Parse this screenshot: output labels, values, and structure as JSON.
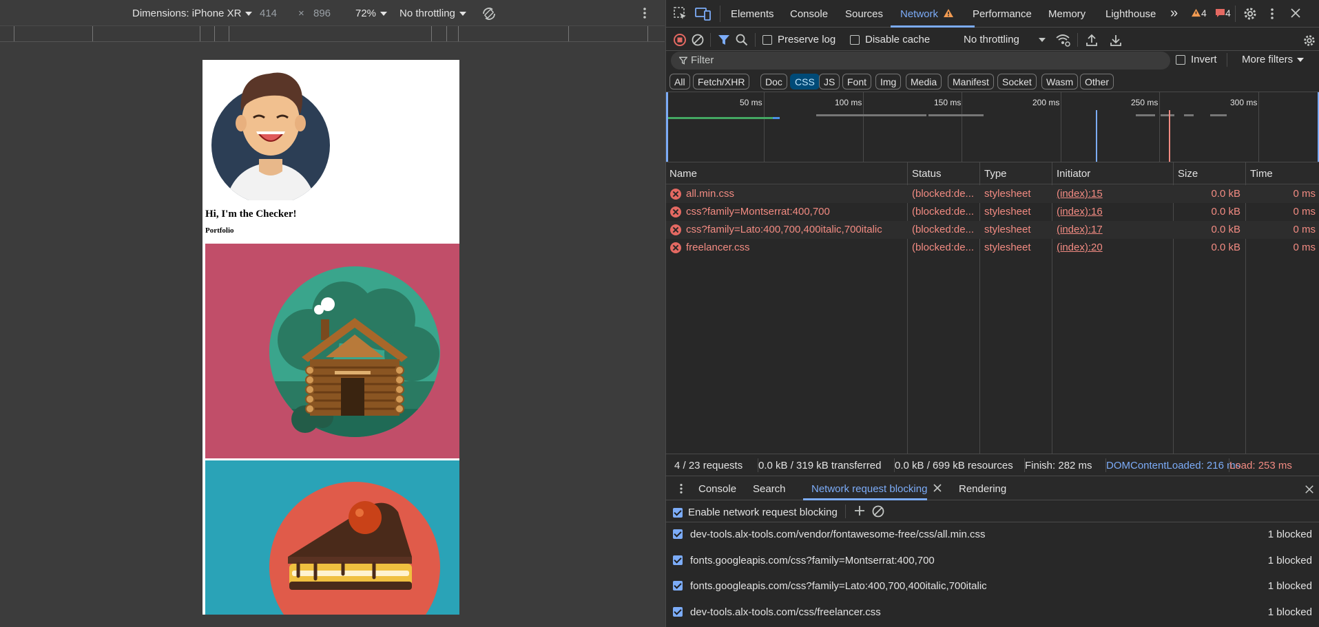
{
  "device_toolbar": {
    "dimensions_label": "Dimensions: iPhone XR",
    "width": "414",
    "times": "×",
    "height": "896",
    "zoom": "72%",
    "throttling": "No throttling"
  },
  "page": {
    "heading": "Hi, I'm the Checker!",
    "subheading": "Portfolio"
  },
  "devtools": {
    "tabs": [
      "Elements",
      "Console",
      "Sources",
      "Network",
      "Performance",
      "Memory",
      "Lighthouse"
    ],
    "more_tabs": "»",
    "warnings_count": "4",
    "errors_count": "4",
    "toolbar": {
      "preserve_log": "Preserve log",
      "disable_cache": "Disable cache",
      "throttling": "No throttling"
    },
    "filter": {
      "placeholder": "Filter",
      "invert": "Invert",
      "more_filters": "More filters"
    },
    "type_chips": [
      "All",
      "Fetch/XHR",
      "Doc",
      "CSS",
      "JS",
      "Font",
      "Img",
      "Media",
      "Manifest",
      "Socket",
      "Wasm",
      "Other"
    ],
    "active_chip": "CSS",
    "overview_ticks": [
      "50 ms",
      "100 ms",
      "150 ms",
      "200 ms",
      "250 ms",
      "300 ms"
    ],
    "columns": [
      "Name",
      "Status",
      "Type",
      "Initiator",
      "Size",
      "Time"
    ],
    "requests": [
      {
        "name": "all.min.css",
        "status": "(blocked:de...",
        "type": "stylesheet",
        "initiator": "(index):15",
        "size": "0.0 kB",
        "time": "0 ms"
      },
      {
        "name": "css?family=Montserrat:400,700",
        "status": "(blocked:de...",
        "type": "stylesheet",
        "initiator": "(index):16",
        "size": "0.0 kB",
        "time": "0 ms"
      },
      {
        "name": "css?family=Lato:400,700,400italic,700italic",
        "status": "(blocked:de...",
        "type": "stylesheet",
        "initiator": "(index):17",
        "size": "0.0 kB",
        "time": "0 ms"
      },
      {
        "name": "freelancer.css",
        "status": "(blocked:de...",
        "type": "stylesheet",
        "initiator": "(index):20",
        "size": "0.0 kB",
        "time": "0 ms"
      }
    ],
    "status_bar": {
      "requests": "4 / 23 requests",
      "transferred": "0.0 kB / 319 kB transferred",
      "resources": "0.0 kB / 699 kB resources",
      "finish": "Finish: 282 ms",
      "dom_content_loaded": "DOMContentLoaded: 216 ms",
      "load": "Load: 253 ms"
    },
    "drawer": {
      "tabs": [
        "Console",
        "Search",
        "Network request blocking",
        "Rendering"
      ],
      "active_tab": "Network request blocking",
      "enable_label": "Enable network request blocking",
      "patterns": [
        {
          "url": "dev-tools.alx-tools.com/vendor/fontawesome-free/css/all.min.css",
          "count": "1 blocked"
        },
        {
          "url": "fonts.googleapis.com/css?family=Montserrat:400,700",
          "count": "1 blocked"
        },
        {
          "url": "fonts.googleapis.com/css?family=Lato:400,700,400italic,700italic",
          "count": "1 blocked"
        },
        {
          "url": "dev-tools.alx-tools.com/css/freelancer.css",
          "count": "1 blocked"
        }
      ]
    }
  },
  "colors": {
    "accent": "#7cacf8",
    "error": "#f28b82",
    "dcl": "#7cacf8",
    "load": "#f28b82",
    "tile1": "#c14e69",
    "tile2": "#2aa3b7"
  }
}
